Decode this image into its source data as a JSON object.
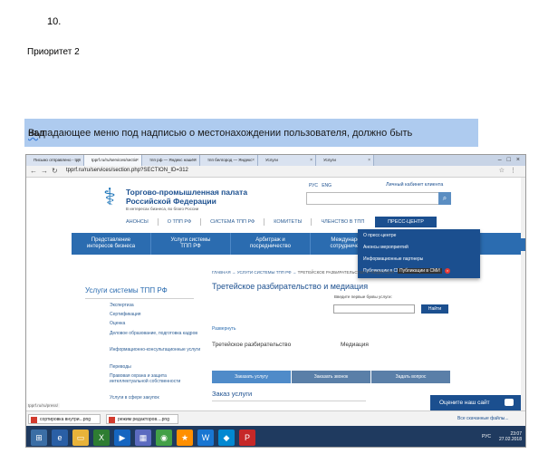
{
  "document": {
    "number": "10.",
    "priority": "Приоритет 2",
    "highlight_main": "Выпадающее меню под надписью о местонахождении пользователя, должно быть ",
    "highlight_under": "над"
  },
  "browser": {
    "tabs": [
      {
        "label": "Письмо отправлено - tpp"
      },
      {
        "label": "tpprf.ru/ru/services/sectio"
      },
      {
        "label": "тпп рф — Яндекс нашёл"
      },
      {
        "label": "тпп белгород — Яндекс"
      },
      {
        "label": "Услуги"
      },
      {
        "label": "Услуги"
      }
    ],
    "url": "tpprf.ru/ru/services/section.php?SECTION_ID=312",
    "status_url": "tpprf.ru/ru/press/"
  },
  "site": {
    "org_name_line1": "Торгово-промышленная палата",
    "org_name_line2": "Российской Федерации",
    "org_tagline": "В интересах бизнеса, во благо России",
    "lang_ru": "РУС",
    "lang_en": "ENG",
    "cabinet": "Личный кабинет клиента",
    "top_nav": [
      "АНОНСЫ",
      "О ТПП РФ",
      "СИСТЕМА ТПП РФ",
      "КОМИТЕТЫ",
      "ЧЛЕНСТВО В ТПП"
    ],
    "press_center": "ПРЕСС-ЦЕНТР",
    "blue_nav": [
      {
        "line1": "Представление",
        "line2": "интересов бизнеса"
      },
      {
        "line1": "Услуги системы",
        "line2": "ТПП РФ"
      },
      {
        "line1": "Арбитраж и",
        "line2": "посредничество"
      },
      {
        "line1": "Международно",
        "line2": "сотрудничество"
      }
    ],
    "dropdown": [
      "О пресс-центре",
      "Анонсы мероприятий",
      "Информационные партнеры",
      "Публикации в СМИ"
    ],
    "dropdown_tooltip": "Публикации в СМИ",
    "breadcrumb": {
      "home": "ГЛАВНАЯ",
      "sep": "→",
      "services": "УСЛУГИ СИСТЕМЫ ТПП РФ",
      "current": "ТРЕТЕЙСКОЕ РАЗБИРАТЕЛЬСТВО И МЕДИАЦИЯ"
    },
    "sidebar_title": "Услуги системы ТПП РФ",
    "sidebar_items": [
      "Экспертиза",
      "Сертификация",
      "Оценка",
      "Деловое образование, подготовка кадров",
      "Информационно-консультационные услуги",
      "Переводы",
      "Правовая охрана и защита интеллектуальной собственности",
      "Услуги в сфере закупок"
    ],
    "page_title": "Третейское разбирательство и медиация",
    "query_label": "Введите первые буквы услуги:",
    "find_button": "Найти",
    "expand": "Развернуть",
    "col_a": "Третейское разбирательство",
    "col_b": "Медиация",
    "tabs": [
      "Заказать услугу",
      "Заказать звонок",
      "Задать вопрос"
    ],
    "order_title": "Заказ услуги",
    "rate_button": "Оцените наш сайт"
  },
  "downloads": [
    {
      "name": "сортировка внутри...png"
    },
    {
      "name": "режим редакторов....png"
    }
  ],
  "downloads_all": "Все скачанные файлы...",
  "tray": {
    "time": "23:07",
    "date": "27.02.2018",
    "lang": "РУС"
  }
}
